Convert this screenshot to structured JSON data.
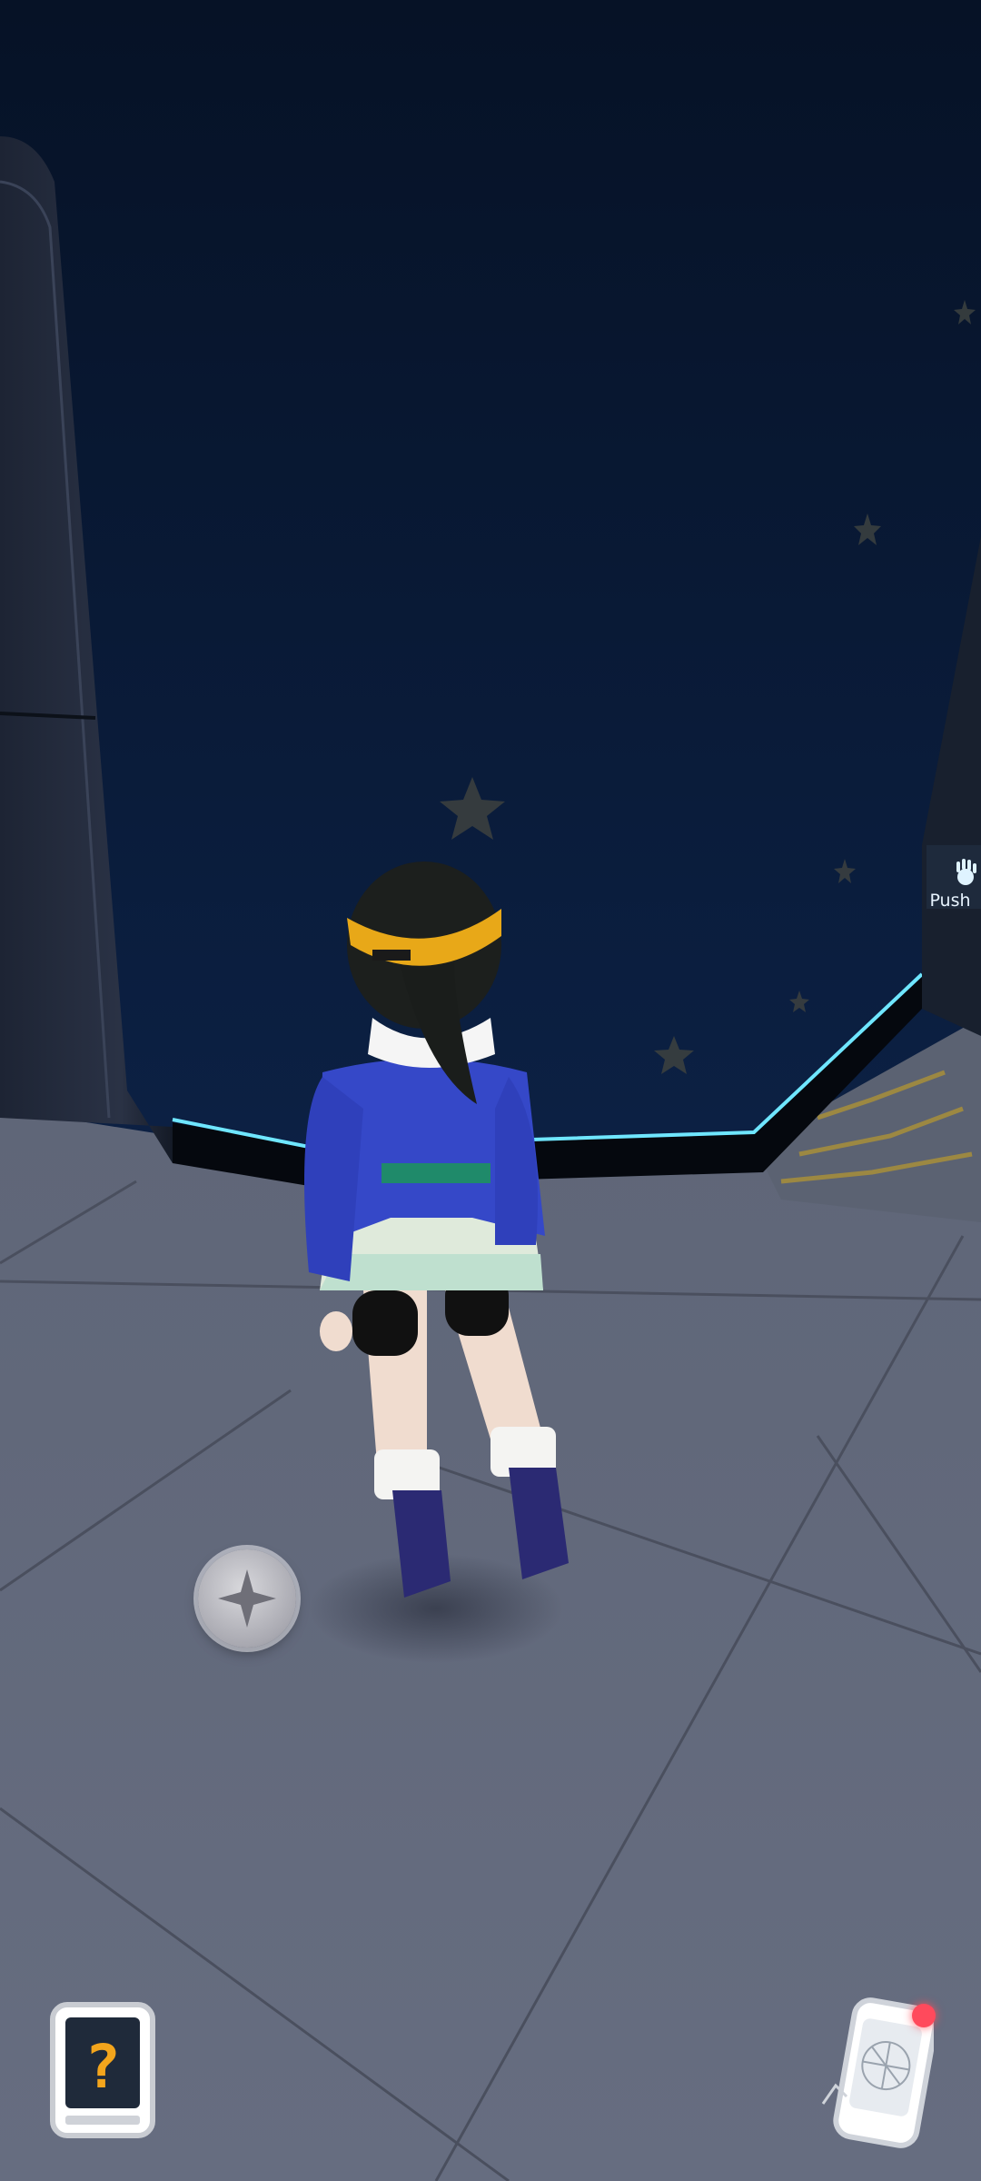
{
  "scene": {
    "wall_sign": {
      "icon": "hand-icon",
      "label": "Push"
    }
  },
  "hud": {
    "joystick": {
      "icon": "dpad-icon"
    },
    "hint_button": {
      "icon": "question-icon",
      "glyph": "?"
    },
    "phone_button": {
      "icon": "rotom-phone-icon",
      "has_notification": true
    }
  },
  "colors": {
    "wall": "#0b1a33",
    "floor": "#6b7285",
    "neon_edge": "#6fe6ff",
    "notification": "#ff4a5c",
    "hint_glyph": "#f3a51c"
  }
}
